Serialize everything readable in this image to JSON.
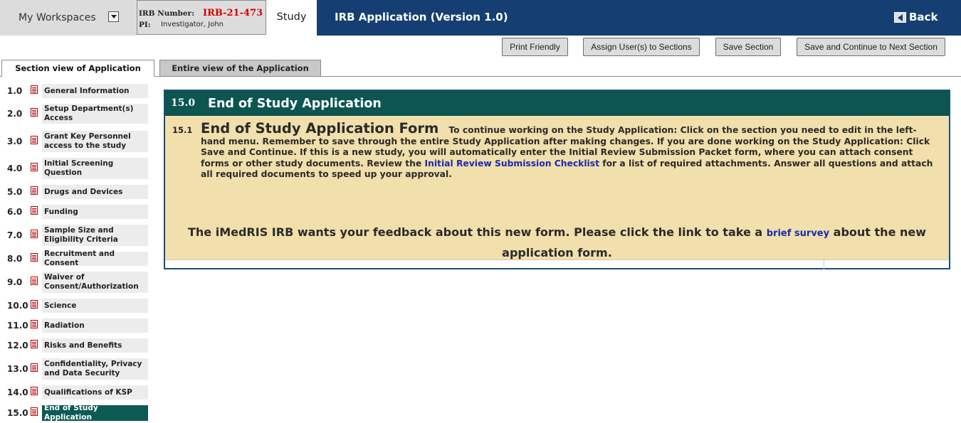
{
  "header": {
    "workspace_label": "My Workspaces",
    "irb_number_label": "IRB Number:",
    "irb_number": "IRB-21-473",
    "pi_label": "PI:",
    "pi_name": "Investigator, John",
    "study_tab": "Study",
    "app_title": "IRB Application (Version 1.0)",
    "back_label": "Back"
  },
  "toolbar": {
    "print_friendly": "Print Friendly",
    "assign_users": "Assign User(s) to Sections",
    "save_section": "Save Section",
    "save_continue": "Save and Continue to Next Section"
  },
  "view_tabs": {
    "section_view": "Section view of Application",
    "entire_view": "Entire view of the Application"
  },
  "sidebar": {
    "items": [
      {
        "num": "1.0",
        "label": "General Information"
      },
      {
        "num": "2.0",
        "label": "Setup Department(s) Access"
      },
      {
        "num": "3.0",
        "label": "Grant Key Personnel access to the study"
      },
      {
        "num": "4.0",
        "label": "Initial Screening Question"
      },
      {
        "num": "5.0",
        "label": "Drugs and Devices"
      },
      {
        "num": "6.0",
        "label": "Funding"
      },
      {
        "num": "7.0",
        "label": "Sample Size and Eligibility Criteria"
      },
      {
        "num": "8.0",
        "label": "Recruitment and Consent"
      },
      {
        "num": "9.0",
        "label": "Waiver of Consent/Authorization"
      },
      {
        "num": "10.0",
        "label": "Science"
      },
      {
        "num": "11.0",
        "label": "Radiation"
      },
      {
        "num": "12.0",
        "label": "Risks and Benefits"
      },
      {
        "num": "13.0",
        "label": "Confidentiality, Privacy and Data Security"
      },
      {
        "num": "14.0",
        "label": "Qualifications of KSP"
      },
      {
        "num": "15.0",
        "label": "End of Study Application"
      }
    ],
    "active_index": 14
  },
  "section": {
    "number": "15.0",
    "title": "End of Study Application",
    "question_number": "15.1",
    "form_title": "End of Study Application Form",
    "instructions_before_link": "To continue working on the Study Application: Click on the section you need to edit in the left-hand menu. Remember to save through the entire Study Application after making changes.  If you are done working on the Study Application: Click Save and Continue. If this is a new study, you will automatically enter the Initial Review Submission Packet form, where you can attach consent forms or other study documents. Review the",
    "checklist_link": "Initial Review Submission Checklist",
    "instructions_after_link": "for a list of required attachments.   Answer all questions and attach all required documents to speed up your approval.",
    "feedback_before_link": "The iMedRIS IRB wants your feedback about this new form. Please click the link to take a",
    "survey_link": "brief survey",
    "feedback_after_link": "about the new application form."
  },
  "colors": {
    "header_blue": "#153f72",
    "section_green": "#0c5550",
    "form_background": "#f1dfac",
    "irb_number_red": "#d40000",
    "link_blue": "#1a2ab0"
  }
}
